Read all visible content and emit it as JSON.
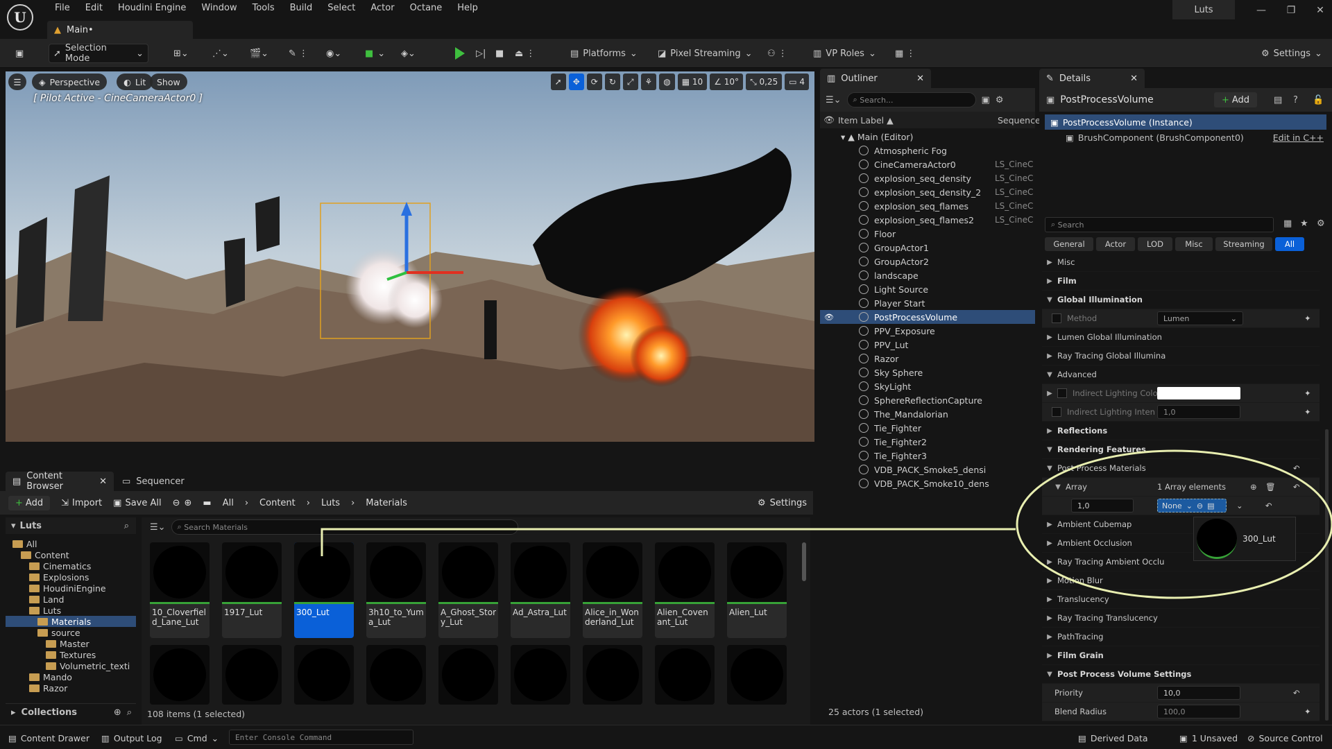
{
  "menu": [
    "File",
    "Edit",
    "Houdini Engine",
    "Window",
    "Tools",
    "Build",
    "Select",
    "Actor",
    "Octane",
    "Help"
  ],
  "project_name": "Luts",
  "level_tab": "Main•",
  "toolbar": {
    "selection_mode": "Selection Mode",
    "platforms": "Platforms",
    "pixel_streaming": "Pixel Streaming",
    "vp_roles": "VP Roles",
    "settings": "Settings"
  },
  "viewport": {
    "perspective": "Perspective",
    "lit": "Lit",
    "show": "Show",
    "grid": "10",
    "angle": "10°",
    "scale": "0,25",
    "camera_speed": "4",
    "pilot": "[ Pilot Active - CineCameraActor0 ]"
  },
  "outliner": {
    "title": "Outliner",
    "search_placeholder": "Search...",
    "col_label": "Item Label",
    "col_seq": "Sequence",
    "root": "Main (Editor)",
    "items": [
      {
        "label": "Atmospheric Fog",
        "seq": ""
      },
      {
        "label": "CineCameraActor0",
        "seq": "LS_CineCa"
      },
      {
        "label": "explosion_seq_density",
        "seq": "LS_CineCa"
      },
      {
        "label": "explosion_seq_density_2",
        "seq": "LS_CineCa"
      },
      {
        "label": "explosion_seq_flames",
        "seq": "LS_CineCa"
      },
      {
        "label": "explosion_seq_flames2",
        "seq": "LS_CineCa"
      },
      {
        "label": "Floor",
        "seq": ""
      },
      {
        "label": "GroupActor1",
        "seq": ""
      },
      {
        "label": "GroupActor2",
        "seq": ""
      },
      {
        "label": "landscape",
        "seq": ""
      },
      {
        "label": "Light Source",
        "seq": ""
      },
      {
        "label": "Player Start",
        "seq": ""
      },
      {
        "label": "PostProcessVolume",
        "seq": ""
      },
      {
        "label": "PPV_Exposure",
        "seq": ""
      },
      {
        "label": "PPV_Lut",
        "seq": ""
      },
      {
        "label": "Razor",
        "seq": ""
      },
      {
        "label": "Sky Sphere",
        "seq": ""
      },
      {
        "label": "SkyLight",
        "seq": ""
      },
      {
        "label": "SphereReflectionCapture",
        "seq": ""
      },
      {
        "label": "The_Mandalorian",
        "seq": ""
      },
      {
        "label": "Tie_Fighter",
        "seq": ""
      },
      {
        "label": "Tie_Fighter2",
        "seq": ""
      },
      {
        "label": "Tie_Fighter3",
        "seq": ""
      },
      {
        "label": "VDB_PACK_Smoke5_densi",
        "seq": ""
      },
      {
        "label": "VDB_PACK_Smoke10_dens",
        "seq": ""
      }
    ],
    "status": "25 actors (1 selected)"
  },
  "details": {
    "title": "Details",
    "object": "PostProcessVolume",
    "add": "Add",
    "instance": "PostProcessVolume (Instance)",
    "component": "BrushComponent (BrushComponent0)",
    "edit_cpp": "Edit in C++",
    "search_placeholder": "Search",
    "filters": [
      "General",
      "Actor",
      "LOD",
      "Misc",
      "Streaming",
      "All"
    ],
    "rows": {
      "misc": "Misc",
      "film": "Film",
      "gi": "Global Illumination",
      "method": "Method",
      "method_value": "Lumen",
      "lumen_gi": "Lumen Global Illumination",
      "rt_gi": "Ray Tracing Global Illumina",
      "advanced": "Advanced",
      "ind_color": "Indirect Lighting Color",
      "ind_int": "Indirect Lighting Inten",
      "ind_int_val": "1,0",
      "reflections": "Reflections",
      "rendering": "Rendering Features",
      "ppm": "Post Process Materials",
      "array": "Array",
      "array_count": "1 Array elements",
      "weight": "1,0",
      "none": "None",
      "tooltip": "300_Lut",
      "cubemap": "Ambient Cubemap",
      "ao": "Ambient Occlusion",
      "rtao": "Ray Tracing Ambient Occlu",
      "motion": "Motion Blur",
      "transl": "Translucency",
      "rttransl": "Ray Tracing Translucency",
      "path": "PathTracing",
      "grain": "Film Grain",
      "ppv_settings": "Post Process Volume Settings",
      "priority": "Priority",
      "priority_val": "10,0",
      "blend": "Blend Radius",
      "blend_val": "100,0"
    }
  },
  "content": {
    "tab": "Content Browser",
    "seq_tab": "Sequencer",
    "add": "Add",
    "import": "Import",
    "save_all": "Save All",
    "crumbs": [
      "All",
      "Content",
      "Luts",
      "Materials"
    ],
    "settings": "Settings",
    "tree_title": "Luts",
    "tree": [
      {
        "label": "All",
        "depth": 0
      },
      {
        "label": "Content",
        "depth": 1
      },
      {
        "label": "Cinematics",
        "depth": 2
      },
      {
        "label": "Explosions",
        "depth": 2
      },
      {
        "label": "HoudiniEngine",
        "depth": 2
      },
      {
        "label": "Land",
        "depth": 2
      },
      {
        "label": "Luts",
        "depth": 2
      },
      {
        "label": "Materials",
        "depth": 3
      },
      {
        "label": "source",
        "depth": 3
      },
      {
        "label": "Master",
        "depth": 4
      },
      {
        "label": "Textures",
        "depth": 4
      },
      {
        "label": "Volumetric_texti",
        "depth": 4
      },
      {
        "label": "Mando",
        "depth": 2
      },
      {
        "label": "Razor",
        "depth": 2
      }
    ],
    "collections": "Collections",
    "search_placeholder": "Search Materials",
    "assets": [
      "10_Cloverfield_Lane_Lut",
      "1917_Lut",
      "300_Lut",
      "3h10_to_Yuma_Lut",
      "A_Ghost_Story_Lut",
      "Ad_Astra_Lut",
      "Alice_in_Wonderland_Lut",
      "Alien_Covenant_Lut",
      "Alien_Lut"
    ],
    "count": "108 items (1 selected)"
  },
  "statusbar": {
    "drawer": "Content Drawer",
    "output": "Output Log",
    "cmd": "Cmd",
    "console_placeholder": "Enter Console Command",
    "derived": "Derived Data",
    "unsaved": "1 Unsaved",
    "source": "Source Control"
  },
  "colors": {
    "accent": "#0a60d8",
    "selection": "#2e4d78",
    "annotation": "#e8eeb0"
  }
}
